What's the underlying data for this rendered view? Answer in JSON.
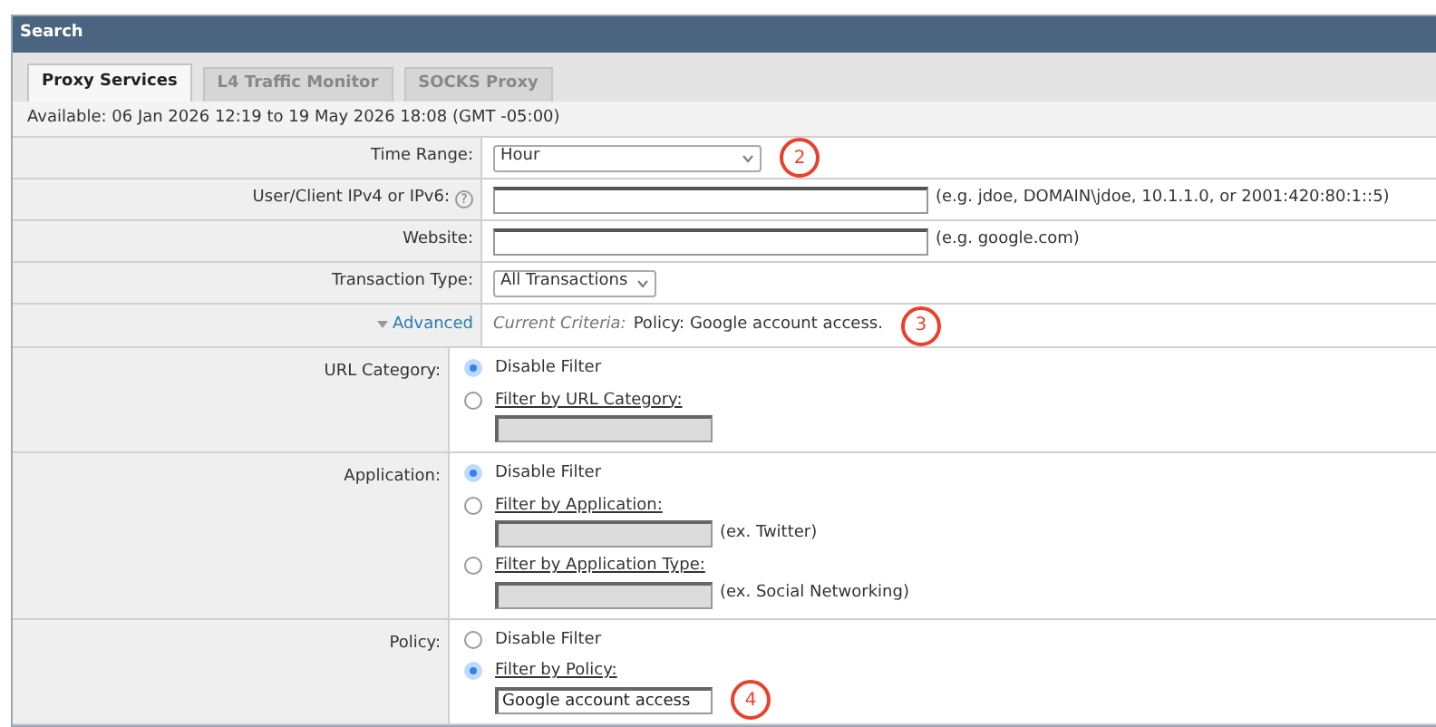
{
  "panel": {
    "title": "Search"
  },
  "tabs": [
    {
      "label": "Proxy Services",
      "selected": true
    },
    {
      "label": "L4 Traffic Monitor",
      "selected": false
    },
    {
      "label": "SOCKS Proxy",
      "selected": false
    }
  ],
  "available": "Available: 06 Jan 2026 12:19 to 19 May 2026 18:08 (GMT -05:00)",
  "fields": [
    {
      "kind": "select",
      "label": "Time Range:",
      "value": "Hour",
      "annotation": "2"
    },
    {
      "kind": "text",
      "label": "User/Client IPv4 or IPv6:",
      "help": "?",
      "hint": "(e.g. jdoe, DOMAIN\\jdoe, 10.1.1.0, or 2001:420:80:1::5)"
    },
    {
      "kind": "text",
      "label": "Website:",
      "hint": "(e.g. google.com)"
    },
    {
      "kind": "select",
      "label": "Transaction Type:",
      "value": "All Transactions"
    }
  ],
  "advanced": {
    "toggle": "Advanced",
    "expanded": true,
    "criteria_label": "Current Criteria:",
    "criteria": "Policy: Google account access.",
    "annotation": "3"
  },
  "filters": [
    {
      "label": "URL Category:",
      "options": [
        {
          "label": "Disable Filter",
          "selected": true
        },
        {
          "label": "Filter by URL Category:",
          "selected": false,
          "field": {
            "disabled": true
          }
        }
      ]
    },
    {
      "label": "Application:",
      "options": [
        {
          "label": "Disable Filter",
          "selected": true
        },
        {
          "label": "Filter by Application:",
          "selected": false,
          "field": {
            "disabled": true,
            "hint": "(ex. Twitter)"
          }
        },
        {
          "label": "Filter by Application Type:",
          "selected": false,
          "field": {
            "disabled": true,
            "hint": "(ex. Social Networking)"
          }
        }
      ]
    },
    {
      "label": "Policy:",
      "options": [
        {
          "label": "Disable Filter",
          "selected": false
        },
        {
          "label": "Filter by Policy:",
          "selected": true,
          "field": {
            "disabled": false,
            "value": "Google account access",
            "annotation": "4"
          }
        }
      ]
    }
  ]
}
